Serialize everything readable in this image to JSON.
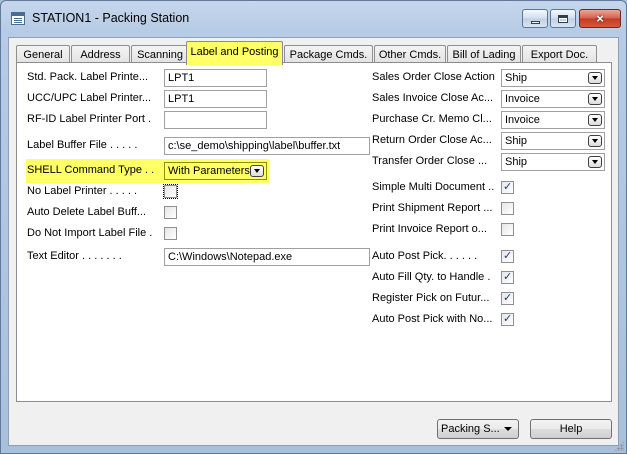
{
  "window": {
    "title": "STATION1 - Packing Station",
    "controls": {
      "minimize": "minimize",
      "maximize": "maximize",
      "close": "×"
    }
  },
  "tabs": [
    {
      "label": "General"
    },
    {
      "label": "Address"
    },
    {
      "label": "Scanning"
    },
    {
      "label": "Label and Posting",
      "active": true
    },
    {
      "label": "Package Cmds."
    },
    {
      "label": "Other Cmds."
    },
    {
      "label": "Bill of Lading"
    },
    {
      "label": "Export Doc."
    }
  ],
  "left_fields": [
    {
      "label": "Std. Pack. Label Printe...",
      "type": "text",
      "value": "LPT1"
    },
    {
      "label": "UCC/UPC Label Printer...",
      "type": "text",
      "value": "LPT1"
    },
    {
      "label": "RF-ID Label Printer Port .",
      "type": "text",
      "value": ""
    },
    {
      "label": "Label Buffer File . . . . .",
      "type": "text",
      "value": "c:\\se_demo\\shipping\\label\\buffer.txt"
    },
    {
      "label": "SHELL Command Type . .",
      "type": "combo",
      "value": "With Parameters",
      "highlighted": true
    },
    {
      "label": "No Label Printer . . . . .",
      "type": "check",
      "checked": false,
      "focused": true
    },
    {
      "label": "Auto Delete Label Buff...",
      "type": "check",
      "checked": false
    },
    {
      "label": "Do Not Import Label File .",
      "type": "check",
      "checked": false
    },
    {
      "label": "Text Editor . . . . . . .",
      "type": "text",
      "value": "C:\\Windows\\Notepad.exe"
    }
  ],
  "right_fields": [
    {
      "label": "Sales Order Close Action.",
      "type": "combo",
      "value": "Ship"
    },
    {
      "label": "Sales Invoice Close Ac...",
      "type": "combo",
      "value": "Invoice"
    },
    {
      "label": "Purchase Cr. Memo Cl...",
      "type": "combo",
      "value": "Invoice"
    },
    {
      "label": "Return Order Close Ac...",
      "type": "combo",
      "value": "Ship"
    },
    {
      "label": "Transfer Order Close ...",
      "type": "combo",
      "value": "Ship"
    },
    {
      "label": "Simple Multi Document ...",
      "type": "check",
      "checked": true
    },
    {
      "label": "Print Shipment Report ...",
      "type": "check",
      "checked": false
    },
    {
      "label": "Print Invoice Report o...",
      "type": "check",
      "checked": false
    },
    {
      "label": "Auto Post Pick. . . . . .",
      "type": "check",
      "checked": true
    },
    {
      "label": "Auto Fill Qty. to Handle .",
      "type": "check",
      "checked": true
    },
    {
      "label": "Register Pick on Futur...",
      "type": "check",
      "checked": true
    },
    {
      "label": "Auto Post Pick with No...",
      "type": "check",
      "checked": true
    }
  ],
  "footer": {
    "packing_button": "Packing S...",
    "help_button": "Help"
  },
  "colors": {
    "highlight": "#ffff66",
    "check_mark": "#1f3a7a"
  },
  "icons": {
    "check_mark": "✓",
    "dropdown": "chevron-down-icon"
  }
}
